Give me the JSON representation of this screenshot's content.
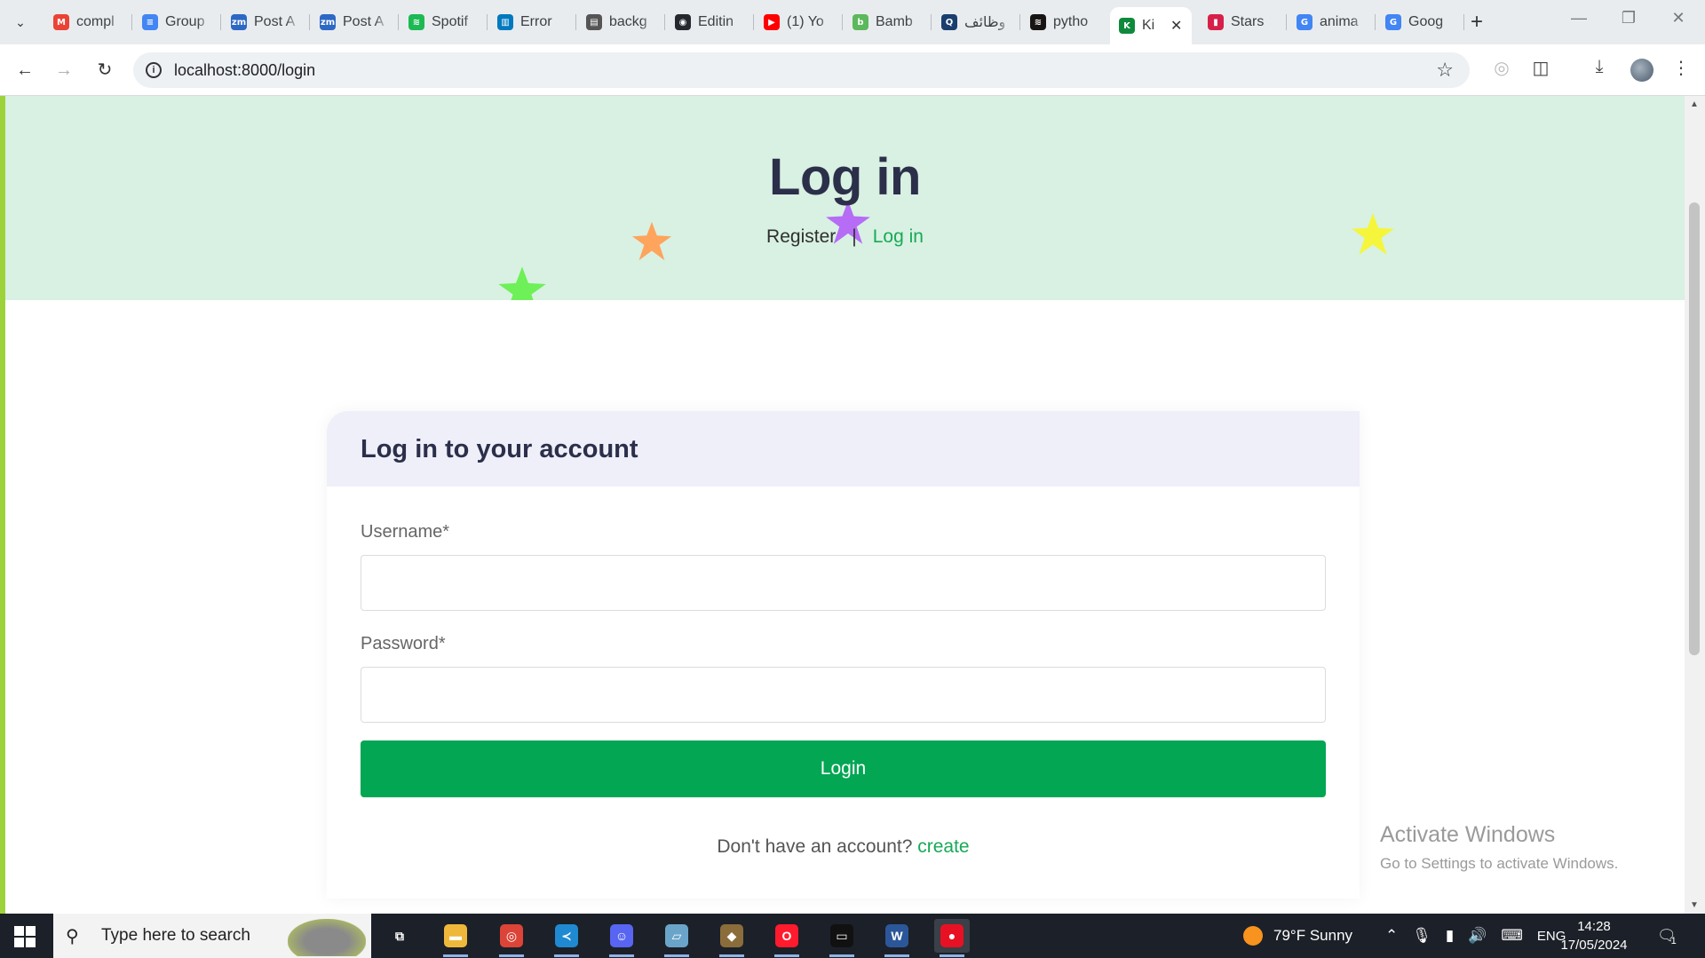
{
  "browser": {
    "tabs": [
      {
        "label": "compl",
        "icon": "gmail-icon",
        "color": "#ea4335",
        "glyph": "M"
      },
      {
        "label": "Group",
        "icon": "docs-icon",
        "color": "#4285f4",
        "glyph": "≡"
      },
      {
        "label": "Post A",
        "icon": "zoom-icon",
        "color": "#2d68c4",
        "glyph": "zm"
      },
      {
        "label": "Post A",
        "icon": "zoom-icon",
        "color": "#2d68c4",
        "glyph": "zm"
      },
      {
        "label": "Spotif",
        "icon": "spotify-icon",
        "color": "#1db954",
        "glyph": "≋"
      },
      {
        "label": "Error",
        "icon": "trello-icon",
        "color": "#0079bf",
        "glyph": "▥"
      },
      {
        "label": "backg",
        "icon": "page-icon",
        "color": "#555555",
        "glyph": "▤"
      },
      {
        "label": "Editin",
        "icon": "github-icon",
        "color": "#24292e",
        "glyph": "◉"
      },
      {
        "label": "(1) Yo",
        "icon": "youtube-icon",
        "color": "#ff0000",
        "glyph": "▶"
      },
      {
        "label": "Bamb",
        "icon": "bamboo-icon",
        "color": "#5cb85c",
        "glyph": "b"
      },
      {
        "label": "وظائف",
        "icon": "search-circle-icon",
        "color": "#1a3e6e",
        "glyph": "Q"
      },
      {
        "label": "pytho",
        "icon": "spotify-icon",
        "color": "#191414",
        "glyph": "≋"
      },
      {
        "label": "Ki",
        "icon": "site-icon",
        "color": "#0f8a3c",
        "glyph": "K",
        "active": true
      },
      {
        "label": "Stars",
        "icon": "bookmark-icon",
        "color": "#d6204a",
        "glyph": "▮"
      },
      {
        "label": "anima",
        "icon": "google-icon",
        "color": "#4285f4",
        "glyph": "G"
      },
      {
        "label": "Goog",
        "icon": "translate-icon",
        "color": "#4285f4",
        "glyph": "G"
      }
    ],
    "url": "localhost:8000/login"
  },
  "page": {
    "hero": {
      "title": "Log in",
      "link_register": "Register",
      "link_separator": "|",
      "link_login": "Log in"
    },
    "form": {
      "heading": "Log in to your account",
      "username_label": "Username*",
      "username_value": "",
      "password_label": "Password*",
      "password_value": "",
      "submit_label": "Login",
      "signup_prompt": "Don't have an account?",
      "signup_link": "create"
    },
    "stars": [
      {
        "color": "#ffa45c"
      },
      {
        "color": "#b66cf5"
      },
      {
        "color": "#f5f53c"
      },
      {
        "color": "#6ef058"
      }
    ],
    "watermark": {
      "line1": "Activate Windows",
      "line2": "Go to Settings to activate Windows."
    }
  },
  "taskbar": {
    "search_placeholder": "Type here to search",
    "apps": [
      {
        "name": "task-view-icon",
        "color": "#1c2028",
        "glyph": "⧉"
      },
      {
        "name": "file-explorer-icon",
        "color": "#f0b83b",
        "glyph": "▬"
      },
      {
        "name": "chrome-icon",
        "color": "#db4437",
        "glyph": "◎"
      },
      {
        "name": "vscode-icon",
        "color": "#1f8ad2",
        "glyph": "≺"
      },
      {
        "name": "discord-icon",
        "color": "#5865f2",
        "glyph": "☺"
      },
      {
        "name": "notes-icon",
        "color": "#6aa5c9",
        "glyph": "▱"
      },
      {
        "name": "git-icon",
        "color": "#8a6d3b",
        "glyph": "◆"
      },
      {
        "name": "opera-icon",
        "color": "#ff1b2d",
        "glyph": "O"
      },
      {
        "name": "terminal-icon",
        "color": "#111111",
        "glyph": "▭"
      },
      {
        "name": "word-icon",
        "color": "#2b579a",
        "glyph": "W"
      },
      {
        "name": "recorder-icon",
        "color": "#e81123",
        "glyph": "●"
      }
    ],
    "weather": "79°F  Sunny",
    "language": "ENG",
    "time": "14:28",
    "date": "17/05/2024",
    "notification_count": "1"
  }
}
